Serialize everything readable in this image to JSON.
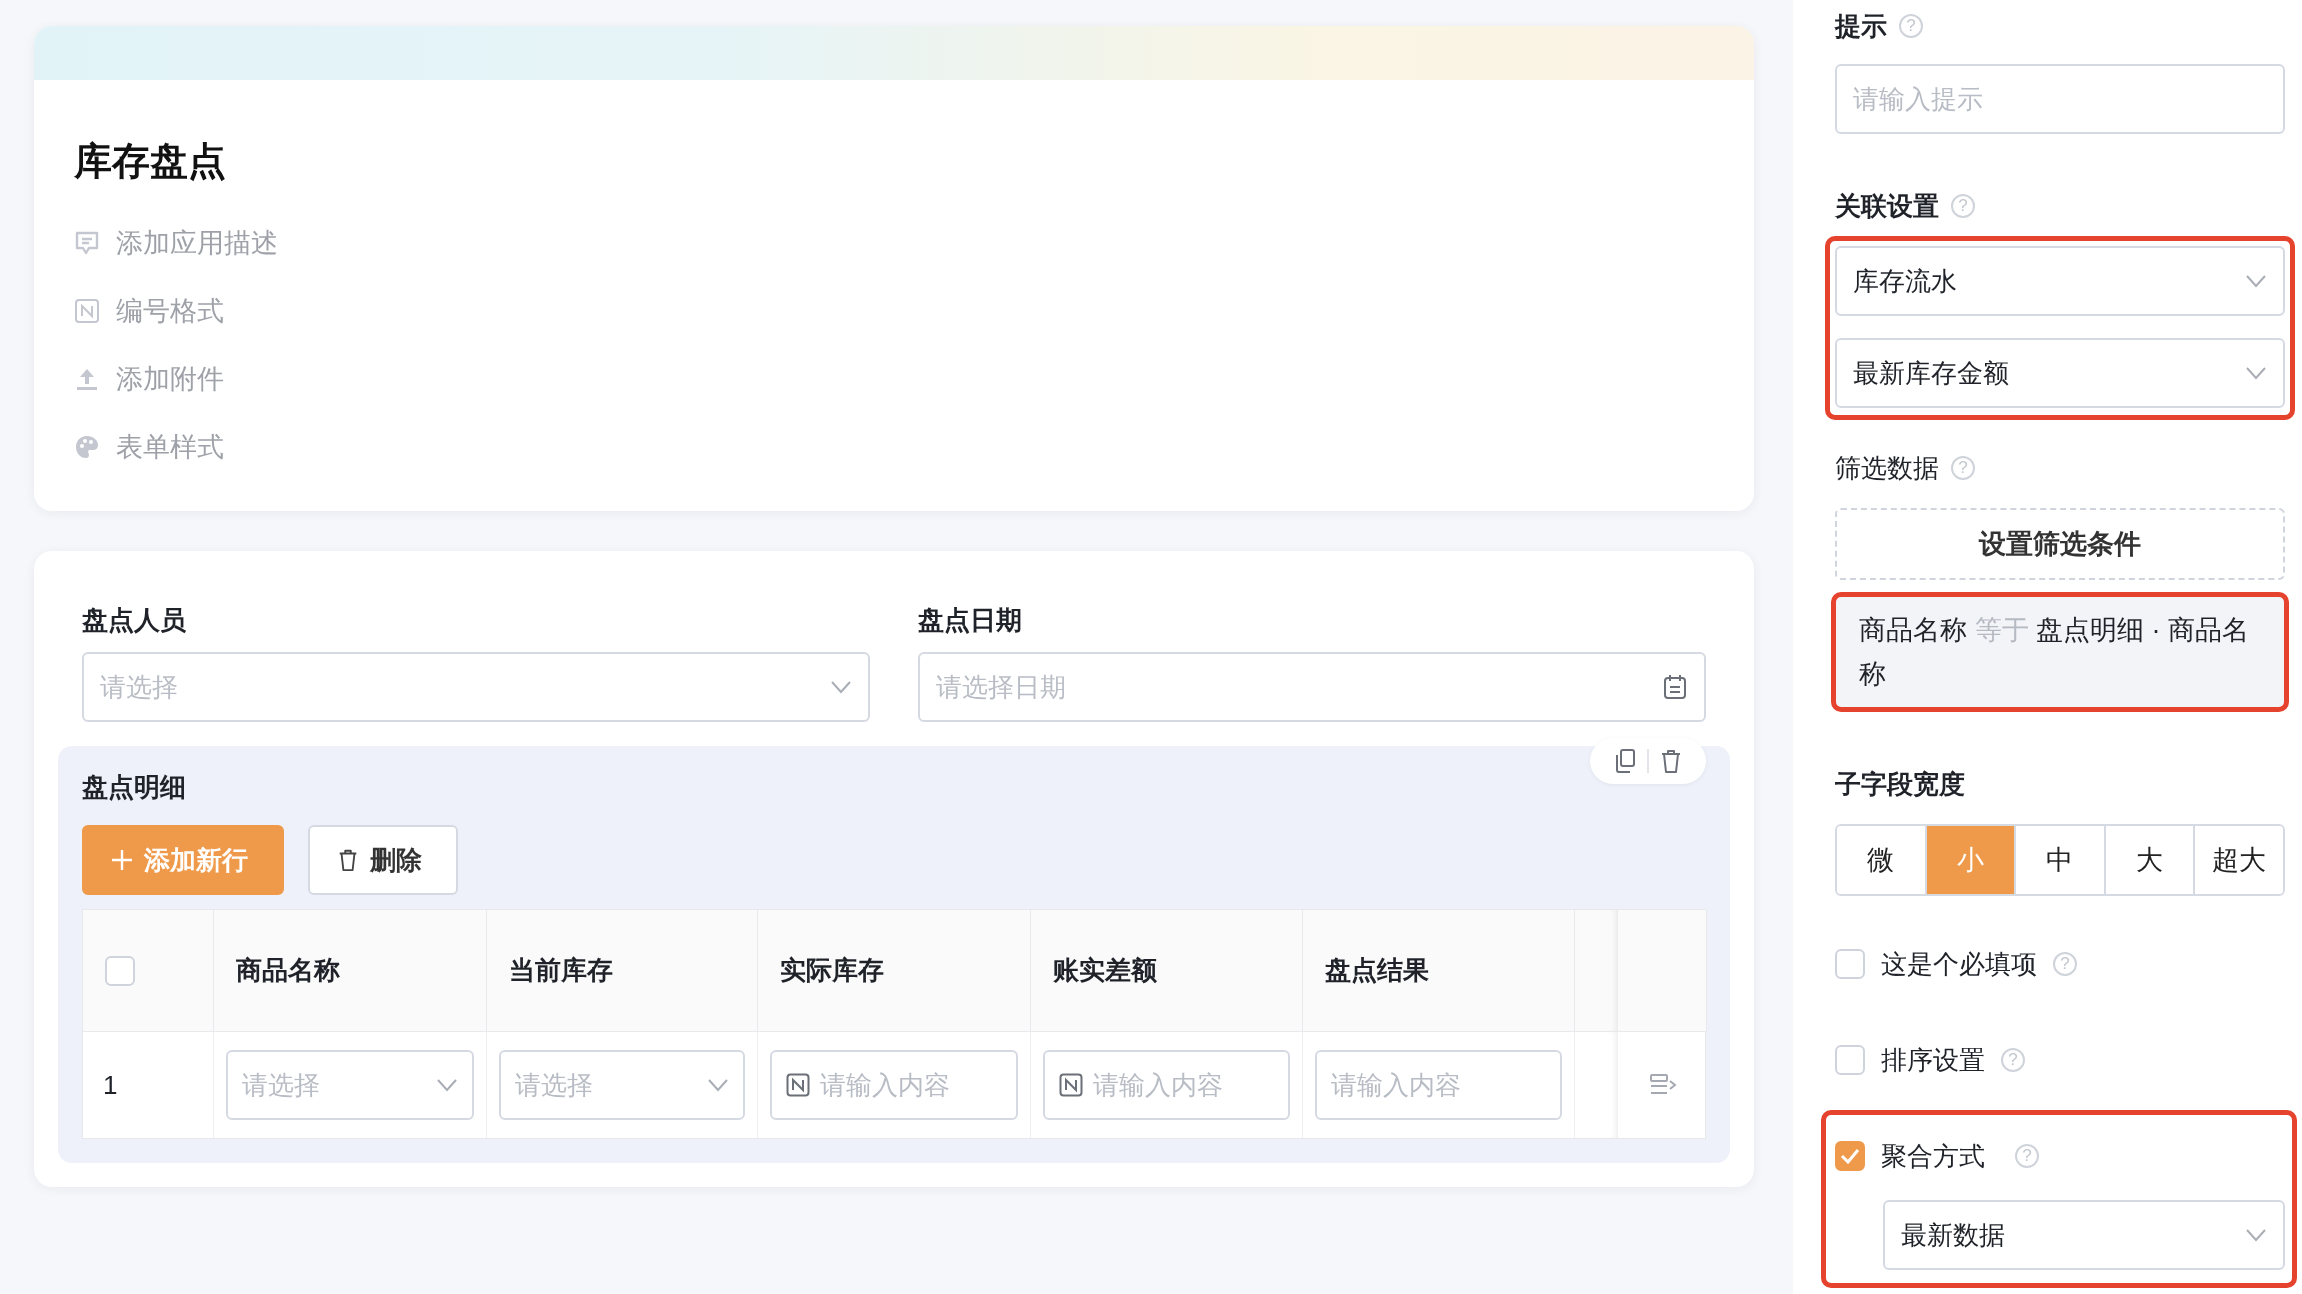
{
  "app": {
    "title": "库存盘点",
    "actions": [
      {
        "kind": "description",
        "label": "添加应用描述"
      },
      {
        "kind": "numbering",
        "label": "编号格式"
      },
      {
        "kind": "attachment",
        "label": "添加附件"
      },
      {
        "kind": "style",
        "label": "表单样式"
      }
    ]
  },
  "form": {
    "fields": [
      {
        "kind": "select",
        "label": "盘点人员",
        "placeholder": "请选择"
      },
      {
        "kind": "date",
        "label": "盘点日期",
        "placeholder": "请选择日期"
      }
    ],
    "subform": {
      "title": "盘点明细",
      "buttons": [
        {
          "kind": "primary",
          "label": "添加新行"
        },
        {
          "kind": "delete",
          "label": "删除"
        }
      ],
      "table": {
        "select_all": {
          "checked": false
        },
        "columns": [
          "商品名称",
          "当前库存",
          "实际库存",
          "账实差额",
          "盘点结果"
        ],
        "rows": [
          {
            "index": "1",
            "cells": [
              {
                "kind": "select",
                "placeholder": "请选择"
              },
              {
                "kind": "select",
                "placeholder": "请选择"
              },
              {
                "kind": "number",
                "placeholder": "请输入内容"
              },
              {
                "kind": "number",
                "placeholder": "请输入内容"
              },
              {
                "kind": "text",
                "placeholder": "请输入内容"
              }
            ]
          }
        ]
      }
    }
  },
  "settings": {
    "sections": [
      {
        "kind": "input",
        "label": "提示",
        "help": "?",
        "placeholder": "请输入提示"
      },
      {
        "kind": "selects",
        "label": "关联设置",
        "help": "?",
        "highlighted": true,
        "values": [
          "库存流水",
          "最新库存金额"
        ]
      },
      {
        "kind": "filter",
        "label": "筛选数据",
        "help": "?",
        "button": "设置筛选条件",
        "condition": {
          "field": "商品名称",
          "operator": "等于",
          "value": "盘点明细 · 商品名称",
          "highlighted": true
        }
      },
      {
        "kind": "segments",
        "label": "子字段宽度",
        "options": [
          {
            "label": "微",
            "selected": false
          },
          {
            "label": "小",
            "selected": true
          },
          {
            "label": "中",
            "selected": false
          },
          {
            "label": "大",
            "selected": false
          },
          {
            "label": "超大",
            "selected": false
          }
        ]
      },
      {
        "kind": "checkbox",
        "label": "这是个必填项",
        "help": "?",
        "checked": false
      },
      {
        "kind": "checkbox",
        "label": "排序设置",
        "help": "?",
        "checked": false
      },
      {
        "kind": "checkbox",
        "label": "聚合方式",
        "help": "?",
        "checked": true,
        "highlighted": true,
        "value": "最新数据"
      }
    ]
  }
}
